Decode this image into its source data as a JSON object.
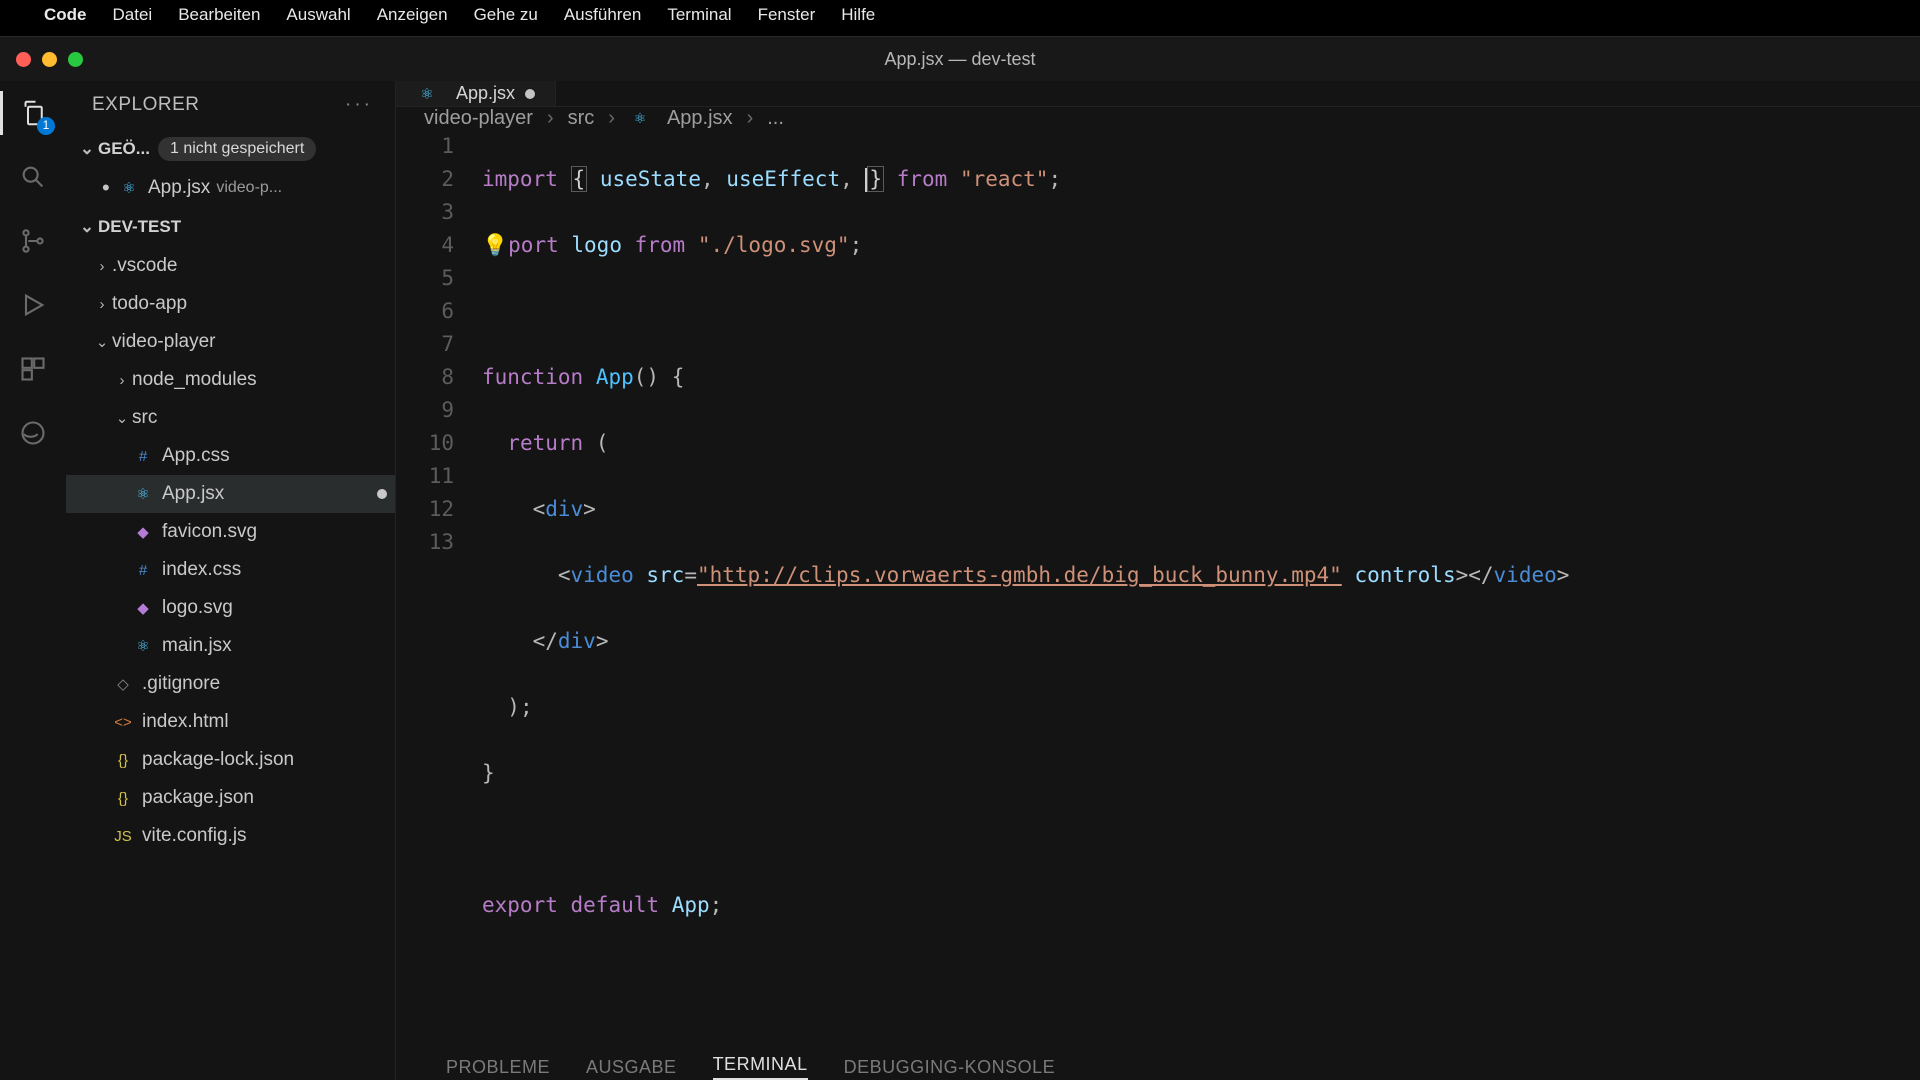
{
  "menubar": {
    "app": "Code",
    "items": [
      "Datei",
      "Bearbeiten",
      "Auswahl",
      "Anzeigen",
      "Gehe zu",
      "Ausführen",
      "Terminal",
      "Fenster",
      "Hilfe"
    ]
  },
  "window": {
    "title": "App.jsx — dev-test"
  },
  "activity": {
    "badge": "1"
  },
  "explorer": {
    "title": "EXPLORER",
    "open_editors": {
      "label": "GEÖ...",
      "unsaved": "1 nicht gespeichert"
    },
    "open_file": {
      "name": "App.jsx",
      "folder": "video-p..."
    },
    "workspace": "DEV-TEST",
    "tree": {
      "vscode": ".vscode",
      "todoapp": "todo-app",
      "videoplayer": "video-player",
      "node_modules": "node_modules",
      "src": "src",
      "files": {
        "appcss": "App.css",
        "appjsx": "App.jsx",
        "favicon": "favicon.svg",
        "indexcss": "index.css",
        "logosvg": "logo.svg",
        "mainjsx": "main.jsx",
        "gitignore": ".gitignore",
        "indexhtml": "index.html",
        "pkglock": "package-lock.json",
        "pkg": "package.json",
        "vite": "vite.config.js"
      }
    }
  },
  "tab": {
    "name": "App.jsx"
  },
  "breadcrumb": {
    "a": "video-player",
    "b": "src",
    "c": "App.jsx",
    "d": "..."
  },
  "code": {
    "lines": [
      "1",
      "2",
      "3",
      "4",
      "5",
      "6",
      "7",
      "8",
      "9",
      "10",
      "11",
      "12",
      "13"
    ],
    "l1": {
      "import": "import",
      "useState": "useState",
      "useEffect": "useEffect",
      "from": "from",
      "react": "\"react\""
    },
    "l2": {
      "port": "port",
      "logo": "logo",
      "from": "from",
      "path": "\"./logo.svg\""
    },
    "l4": {
      "function": "function",
      "App": "App"
    },
    "l5": {
      "return": "return"
    },
    "l6": {
      "div": "div"
    },
    "l7": {
      "video": "video",
      "src": "src",
      "url": "\"http://clips.vorwaerts-gmbh.de/big_buck_bunny.mp4\"",
      "controls": "controls"
    },
    "l8": {
      "div": "div"
    },
    "l12": {
      "export": "export",
      "default": "default",
      "App": "App"
    }
  },
  "panel": {
    "probleme": "PROBLEME",
    "ausgabe": "AUSGABE",
    "terminal": "TERMINAL",
    "debug": "DEBUGGING-KONSOLE"
  }
}
